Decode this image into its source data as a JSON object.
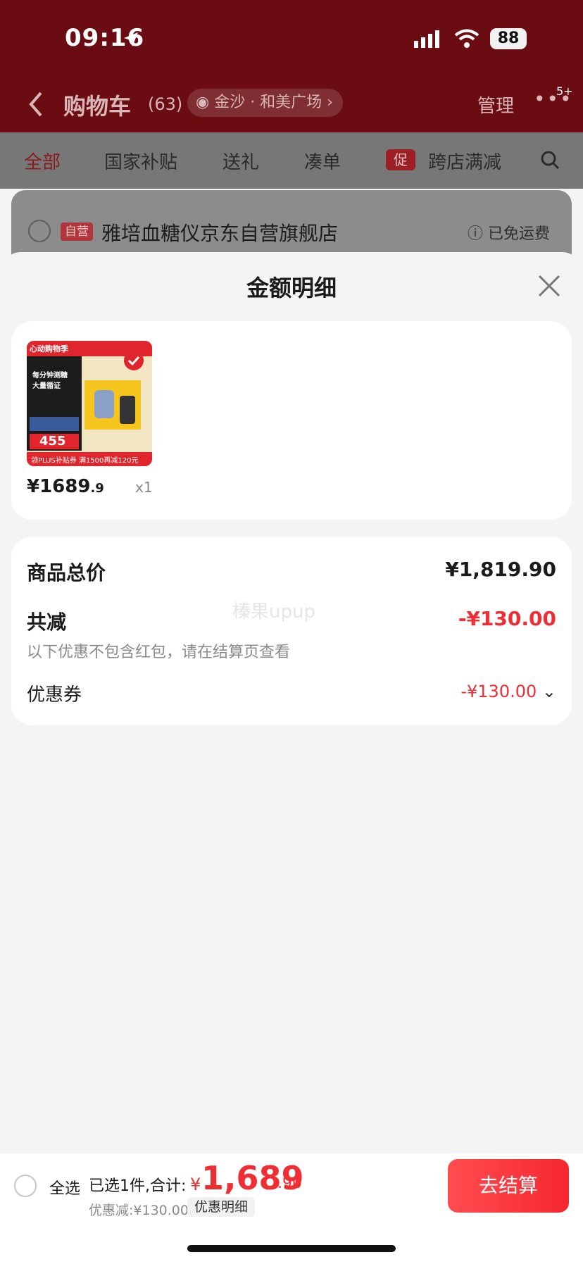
{
  "status": {
    "time": "09:16",
    "battery": "88"
  },
  "cart": {
    "title": "购物车",
    "count": "(63)",
    "location": "金沙 · 和美广场",
    "manage": "管理",
    "more_badge": "5+"
  },
  "tabs": [
    "全部",
    "国家补贴",
    "送礼",
    "凑单",
    "跨店满减"
  ],
  "promo_tag": "促",
  "store": {
    "tag": "自营",
    "name": "雅培血糖仪京东自营旗舰店",
    "shipping": "已免运费"
  },
  "sheet": {
    "title": "金额明细"
  },
  "product": {
    "price_int": "¥1689",
    "price_dec": ".9",
    "qty": "x1",
    "thumb_texts": {
      "brand": "心动购物季",
      "badge": "每分钟测糖\n大量循证",
      "price": "455",
      "footer": "领PLUS补贴券 满1500再减120元"
    }
  },
  "summary": {
    "total_label": "商品总价",
    "total_value": "¥1,819.90",
    "discount_label": "共减",
    "discount_value": "-¥130.00",
    "note": "以下优惠不包含红包，请在结算页查看",
    "coupon_label": "优惠券",
    "coupon_value": "-¥130.00"
  },
  "watermark": "榛果upup",
  "bottom": {
    "select_all": "全选",
    "selected": "已选1件,合计:",
    "yen": "¥",
    "total_int": "1,689",
    "total_dec": ".90",
    "saved": "优惠减:¥130.00",
    "detail_link": "优惠明细",
    "checkout": "去结算"
  },
  "colors": {
    "accent": "#f02d33",
    "dark_red": "#6a0c12"
  }
}
